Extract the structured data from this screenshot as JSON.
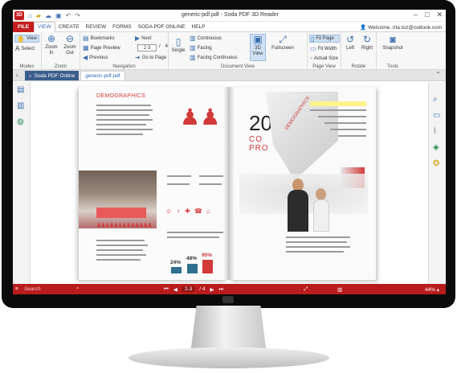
{
  "window": {
    "title": "generic-pdf.pdf - Soda PDF 3D Reader",
    "app_icon": "3D",
    "quick_access": [
      "home-icon",
      "folder-icon",
      "cloud-icon",
      "save-icon",
      "undo-icon",
      "redo-icon"
    ]
  },
  "menu": {
    "file": "FILE",
    "tabs": [
      "VIEW",
      "CREATE",
      "REVIEW",
      "FORMS",
      "SODA PDF ONLINE",
      "HELP"
    ],
    "active_tab": "VIEW",
    "user": "Welcome, rita.toz@outlook.com"
  },
  "ribbon": {
    "modes": {
      "label": "Modes",
      "view": "View",
      "select": "Select"
    },
    "zoom": {
      "label": "Zoom",
      "zoom_in": "Zoom In",
      "zoom_out": "Zoom Out"
    },
    "navigation": {
      "label": "Navigation",
      "bookmarks": "Bookmarks",
      "page_preview": "Page Preview",
      "previous": "Previous",
      "next": "Next",
      "current_page": "2-3",
      "separator": "/",
      "total_pages": "4",
      "go_to_page": "Go to Page"
    },
    "document_view": {
      "label": "Document View",
      "single": "Single",
      "continuous": "Continuous",
      "facing": "Facing",
      "facing_continuous": "Facing Continuous",
      "view_3d": "3D View",
      "fullscreen": "Fullscreen"
    },
    "page_view": {
      "label": "Page View",
      "fit_page": "Fit Page",
      "fit_width": "Fit Width",
      "actual_size": "Actual Size"
    },
    "rotate": {
      "label": "Rotate",
      "left": "Left",
      "right": "Right"
    },
    "tools": {
      "label": "Tools",
      "snapshot": "Snapshot"
    }
  },
  "doc_tabs": {
    "home": "Soda PDF Online",
    "active": "generic-pdf.pdf"
  },
  "document": {
    "left_heading": "DEMOGRAPHICS",
    "percent_1": "24%",
    "percent_2": "48%",
    "percent_3": "95%",
    "right_big": "20",
    "right_sub": "CO",
    "right_sub2": "PRO",
    "curl_text": "DEMOGRAPHICS"
  },
  "status": {
    "search": "Search",
    "page": "2-3",
    "total": "/ 4",
    "zoom": "44%"
  },
  "colors": {
    "accent": "#c41e1e",
    "ribbon_blue": "#3b6fb0",
    "status_bar": "#b81c1c"
  }
}
